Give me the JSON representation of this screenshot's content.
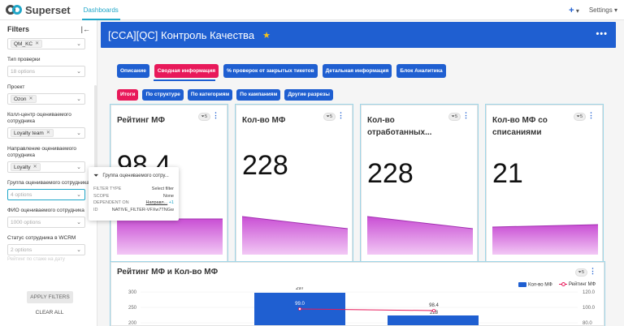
{
  "topbar": {
    "brand": "Superset",
    "nav_dashboards": "Dashboards",
    "plus": "+",
    "settings": "Settings"
  },
  "filters": {
    "title": "Filters",
    "f0_tag": "QM_KC",
    "f1_label": "Тип проверки",
    "f1_placeholder": "18 options",
    "f2_label": "Проект",
    "f2_tag": "Ozon",
    "f3_label": "Колл-центр оцениваемого сотрудника",
    "f3_tag": "Loyalty team",
    "f4_label": "Направление оцениваемого сотрудника",
    "f4_tag": "Loyalty",
    "f5_label": "Группа оцениваемого сотрудника",
    "f5_placeholder": "4 options",
    "f6_label": "ФИО оцениваемого сотрудника",
    "f6_placeholder": "1000 options",
    "f7_label": "Статус сотрудника в WCRM",
    "f7_placeholder": "2 options",
    "fade_text": "Рейтинг по стаже на дату",
    "apply": "APPLY FILTERS",
    "clear": "CLEAR ALL"
  },
  "popover": {
    "title": "Группа оцениваемого сотру...",
    "rows": [
      {
        "k": "FILTER TYPE",
        "v": "Select filter"
      },
      {
        "k": "SCOPE",
        "v": "None"
      },
      {
        "k": "DEPENDENT ON",
        "v": "Направл...",
        "extra": "+1"
      },
      {
        "k": "ID",
        "v": "NATIVE_FILTER-VFXw7TNGw"
      }
    ]
  },
  "dashboard": {
    "title": "[CCA][QC] Контроль Качества",
    "tabs": [
      "Описание",
      "Сводная информация",
      "% проверок от закрытых тикетов",
      "Детальная информация",
      "Блок Аналитика"
    ],
    "subtabs": [
      "Итоги",
      "По структуре",
      "По категориям",
      "По кампаниям",
      "Другие разрезы"
    ]
  },
  "cards": [
    {
      "title": "Рейтинг МФ",
      "value": "98.4",
      "badge": "5"
    },
    {
      "title": "Кол-во МФ",
      "value": "228",
      "badge": "5"
    },
    {
      "title": "Кол-во отработанных...",
      "value": "228",
      "badge": "5"
    },
    {
      "title": "Кол-во МФ со списаниями",
      "value": "21",
      "badge": "5"
    }
  ],
  "combo": {
    "title": "Рейтинг МФ и Кол-во МФ",
    "badge": "5",
    "legend_bar": "Кол-во МФ",
    "legend_line": "Рейтинг МФ",
    "left_ticks": [
      "300",
      "250",
      "200"
    ],
    "right_ticks": [
      "120.0",
      "100.0",
      "80.0"
    ],
    "bar1_label": "297",
    "bar2_label": "228",
    "line1_label": "99.0",
    "line2_label": "98.4"
  },
  "colors": {
    "accent": "#1f5fd1",
    "pink": "#e8195a",
    "brand_teal": "#20a7c9"
  }
}
